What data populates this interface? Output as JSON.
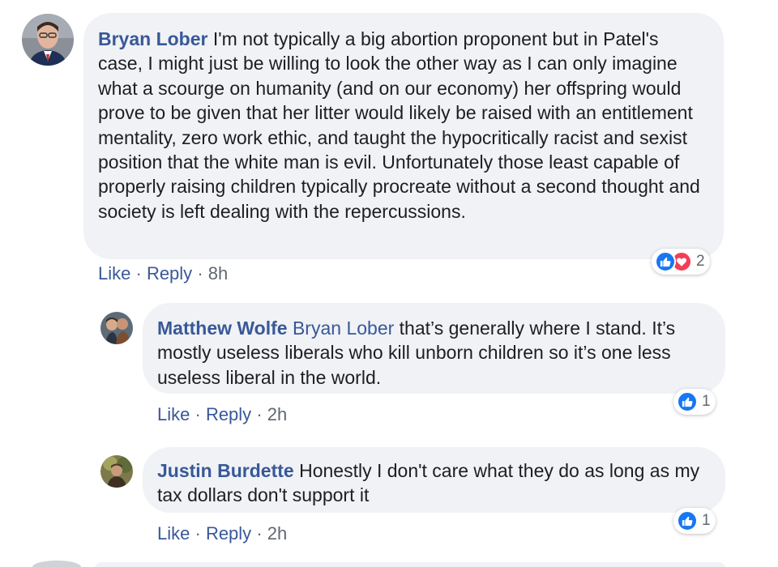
{
  "colors": {
    "author": "#385898",
    "text": "#1c1e21",
    "muted": "#606770",
    "bubble": "#f0f2f5",
    "like": "#1877f2",
    "love": "#f33e58"
  },
  "comments": [
    {
      "author": "Bryan Lober",
      "mention": "",
      "text": "I'm not typically a big abortion proponent but in Patel's case, I might just be willing to look the other way as I can only imagine what a scourge on humanity (and on our economy) her offspring would prove to be given that her litter would likely be raised with an entitlement mentality, zero work ethic, and taught the hypocritically racist and sexist position that the white man is evil. Unfortunately those least capable of properly raising children typically procreate without a second thought and society is left dealing with the repercussions.",
      "like_label": "Like",
      "reply_label": "Reply",
      "separator": "·",
      "time": "8h",
      "reaction_icons": [
        "like-icon",
        "love-icon"
      ],
      "reaction_count": "2"
    },
    {
      "author": "Matthew Wolfe",
      "mention": "Bryan Lober",
      "text": "that’s generally where I stand. It’s mostly useless liberals who kill unborn children so it’s one less useless liberal in the world.",
      "like_label": "Like",
      "reply_label": "Reply",
      "separator": "·",
      "time": "2h",
      "reaction_icons": [
        "like-icon"
      ],
      "reaction_count": "1"
    },
    {
      "author": "Justin Burdette",
      "mention": "",
      "text": "Honestly I don't care what they do as long as my tax dollars don't support it",
      "like_label": "Like",
      "reply_label": "Reply",
      "separator": "·",
      "time": "2h",
      "reaction_icons": [
        "like-icon"
      ],
      "reaction_count": "1"
    }
  ]
}
